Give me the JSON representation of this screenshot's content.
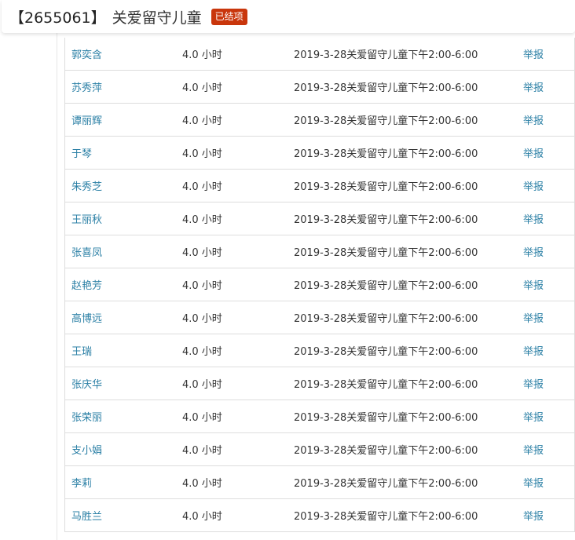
{
  "header": {
    "project_id": "【2655061】",
    "project_title": "关爱留守儿童",
    "status_badge": "已结项"
  },
  "records": [
    {
      "name": "郭奕含",
      "hours": "4.0 小时",
      "description": "2019-3-28关爱留守儿童下午2:00-6:00",
      "action": "举报"
    },
    {
      "name": "苏秀萍",
      "hours": "4.0 小时",
      "description": "2019-3-28关爱留守儿童下午2:00-6:00",
      "action": "举报"
    },
    {
      "name": "谭丽辉",
      "hours": "4.0 小时",
      "description": "2019-3-28关爱留守儿童下午2:00-6:00",
      "action": "举报"
    },
    {
      "name": "于琴",
      "hours": "4.0 小时",
      "description": "2019-3-28关爱留守儿童下午2:00-6:00",
      "action": "举报"
    },
    {
      "name": "朱秀芝",
      "hours": "4.0 小时",
      "description": "2019-3-28关爱留守儿童下午2:00-6:00",
      "action": "举报"
    },
    {
      "name": "王丽秋",
      "hours": "4.0 小时",
      "description": "2019-3-28关爱留守儿童下午2:00-6:00",
      "action": "举报"
    },
    {
      "name": "张喜凤",
      "hours": "4.0 小时",
      "description": "2019-3-28关爱留守儿童下午2:00-6:00",
      "action": "举报"
    },
    {
      "name": "赵艳芳",
      "hours": "4.0 小时",
      "description": "2019-3-28关爱留守儿童下午2:00-6:00",
      "action": "举报"
    },
    {
      "name": "高博远",
      "hours": "4.0 小时",
      "description": "2019-3-28关爱留守儿童下午2:00-6:00",
      "action": "举报"
    },
    {
      "name": "王瑞",
      "hours": "4.0 小时",
      "description": "2019-3-28关爱留守儿童下午2:00-6:00",
      "action": "举报"
    },
    {
      "name": "张庆华",
      "hours": "4.0 小时",
      "description": "2019-3-28关爱留守儿童下午2:00-6:00",
      "action": "举报"
    },
    {
      "name": "张荣丽",
      "hours": "4.0 小时",
      "description": "2019-3-28关爱留守儿童下午2:00-6:00",
      "action": "举报"
    },
    {
      "name": "支小娟",
      "hours": "4.0 小时",
      "description": "2019-3-28关爱留守儿童下午2:00-6:00",
      "action": "举报"
    },
    {
      "name": "李莉",
      "hours": "4.0 小时",
      "description": "2019-3-28关爱留守儿童下午2:00-6:00",
      "action": "举报"
    },
    {
      "name": "马胜兰",
      "hours": "4.0 小时",
      "description": "2019-3-28关爱留守儿童下午2:00-6:00",
      "action": "举报"
    }
  ],
  "colors": {
    "link": "#2a7fa5",
    "badge": "#c9360c",
    "border": "#dddddd"
  }
}
